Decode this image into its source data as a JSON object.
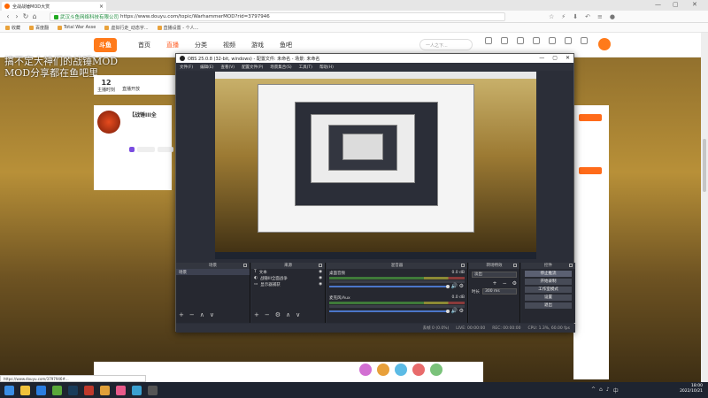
{
  "browser": {
    "tab_title": "全战战锤MOD大赏",
    "url": "https://www.douyu.com/topic/WarhammerMOD?rid=3797946",
    "url_prefix": "",
    "site_owner": "武汉斗鱼网络科技有限公司",
    "bookmarks": [
      {
        "label": "收藏"
      },
      {
        "label": "百度翻"
      },
      {
        "label": "Total War Asse"
      },
      {
        "label": "虚拟行走_动态字..."
      },
      {
        "label": "直播设置 - 个人..."
      }
    ],
    "status_url": "https://www.douyu.com/3797946#..."
  },
  "site": {
    "logo": "斗鱼",
    "nav": [
      "首页",
      "直播",
      "分类",
      "视频",
      "游戏",
      "鱼吧"
    ],
    "active_nav": "直播",
    "search_placeholder": "一人之下...",
    "header_icons": [
      "",
      "",
      "",
      "",
      "",
      "",
      ""
    ],
    "subnav_num": "12",
    "subnav_label": "主播时刻",
    "subnav_label2": "直播开放"
  },
  "overlay_text": [
    "搞不定大神们的战锤MOD",
    "MOD分享都在鱼吧里"
  ],
  "obs": {
    "title": "OBS 25.0.8 (32-bit, windows) - 配置文件: 未命名 - 场景: 未命名",
    "menu": [
      "文件(F)",
      "编辑(E)",
      "查看(V)",
      "配置文件(P)",
      "场景集合(S)",
      "工具(T)",
      "帮助(H)"
    ],
    "docks": {
      "scenes": {
        "title": "场景",
        "items": [
          "场景"
        ]
      },
      "sources": {
        "title": "来源",
        "items": [
          "文本",
          "战锤III全面战争",
          "显示器捕获"
        ]
      },
      "mixer": {
        "title": "混音器",
        "tracks": [
          {
            "name": "桌面音频",
            "db": "0.0 dB"
          },
          {
            "name": "麦克风/Aux",
            "db": "0.0 dB"
          }
        ]
      },
      "transitions": {
        "title": "转场特效",
        "type": "淡出",
        "duration_label": "时长",
        "duration": "300 ms"
      },
      "controls": {
        "title": "控件",
        "buttons": [
          "停止推流",
          "开始录制",
          "工作室模式",
          "设置",
          "退出"
        ]
      }
    },
    "status": {
      "live": "LIVE: 00:00:00",
      "rec": "REC: 00:00:00",
      "cpu": "CPU: 1.3%, 60.00 fps",
      "lost": "丢帧 0 (0.0%)"
    }
  },
  "taskbar": {
    "time": "18:00",
    "date": "2022/10/21"
  },
  "colors": {
    "douyu_orange": "#ff7a1a",
    "obs_dark": "#2b2e38",
    "taskbar": "#1e2430"
  }
}
